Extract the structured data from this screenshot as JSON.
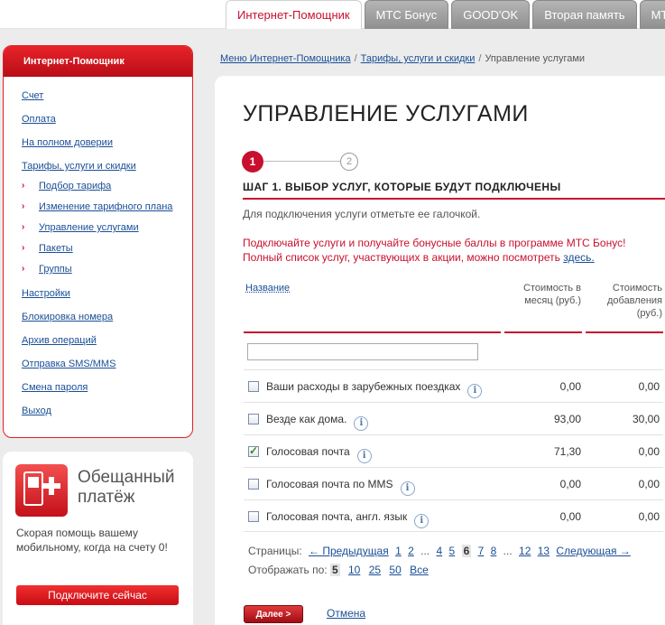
{
  "tabs": [
    {
      "label": "Интернет-Помощник",
      "active": true
    },
    {
      "label": "МТС Бонус",
      "active": false
    },
    {
      "label": "GOOD'OK",
      "active": false
    },
    {
      "label": "Вторая память",
      "active": false
    },
    {
      "label": "МТС",
      "active": false
    }
  ],
  "sidebar": {
    "title": "Интернет-Помощник",
    "items": [
      {
        "label": "Счет"
      },
      {
        "label": "Оплата"
      },
      {
        "label": "На полном доверии"
      },
      {
        "label": "Тарифы, услуги и скидки"
      }
    ],
    "subitems": [
      {
        "label": "Подбор тарифа"
      },
      {
        "label": "Изменение тарифного плана"
      },
      {
        "label": "Управление услугами"
      },
      {
        "label": "Пакеты"
      },
      {
        "label": "Группы"
      }
    ],
    "items2": [
      {
        "label": "Настройки"
      },
      {
        "label": "Блокировка номера"
      },
      {
        "label": "Архив операций"
      },
      {
        "label": "Отправка SMS/MMS"
      },
      {
        "label": "Смена пароля"
      },
      {
        "label": "Выход"
      }
    ]
  },
  "promo": {
    "title_line1": "Обещанный",
    "title_line2": "платёж",
    "text": "Скорая помощь вашему мобильному, когда на счету 0!",
    "button": "Подключите сейчас"
  },
  "breadcrumb": {
    "items": [
      "Меню Интернет-Помощника",
      "Тарифы, услуги и скидки"
    ],
    "current": "Управление услугами"
  },
  "main": {
    "title": "УПРАВЛЕНИЕ УСЛУГАМИ",
    "step_current": "1",
    "step_next": "2",
    "step_title": "ШАГ 1. ВЫБОР УСЛУГ, КОТОРЫЕ БУДУТ ПОДКЛЮЧЕНЫ",
    "hint": "Для подключения услуги отметьте ее галочкой.",
    "promo_line1": "Подключайте услуги и получайте бонусные баллы в программе МТС Бонус!",
    "promo_line2": "Полный список услуг, участвующих в акции, можно посмотреть",
    "promo_link": "здесь."
  },
  "table": {
    "col_name": "Название",
    "col_month_1": "Стоимость в",
    "col_month_2": "месяц (руб.)",
    "col_add_1": "Стоимость",
    "col_add_2": "добавления",
    "col_add_3": "(руб.)",
    "filter_value": "",
    "rows": [
      {
        "name": "Ваши расходы в зарубежных поездках",
        "month": "0,00",
        "add": "0,00",
        "checked": false
      },
      {
        "name": "Везде как дома.",
        "month": "93,00",
        "add": "30,00",
        "checked": false
      },
      {
        "name": "Голосовая почта",
        "month": "71,30",
        "add": "0,00",
        "checked": true
      },
      {
        "name": "Голосовая почта по MMS",
        "month": "0,00",
        "add": "0,00",
        "checked": false
      },
      {
        "name": "Голосовая почта, англ. язык",
        "month": "0,00",
        "add": "0,00",
        "checked": false
      }
    ],
    "info_glyph": "i"
  },
  "pager": {
    "label": "Страницы:",
    "prev": "← Предыдущая",
    "pages_before": [
      "1",
      "2"
    ],
    "ellipsis1": "...",
    "pages_mid": [
      "4",
      "5"
    ],
    "current": "6",
    "pages_after": [
      "7",
      "8"
    ],
    "ellipsis2": "...",
    "pages_end": [
      "12",
      "13"
    ],
    "next": "Следующая →"
  },
  "perpage": {
    "label": "Отображать по:",
    "current": "5",
    "options": [
      "10",
      "25",
      "50",
      "Все"
    ]
  },
  "actions": {
    "next": "Далее >",
    "cancel": "Отмена"
  },
  "colors": {
    "accent": "#c8102e",
    "link": "#1a4f96"
  }
}
